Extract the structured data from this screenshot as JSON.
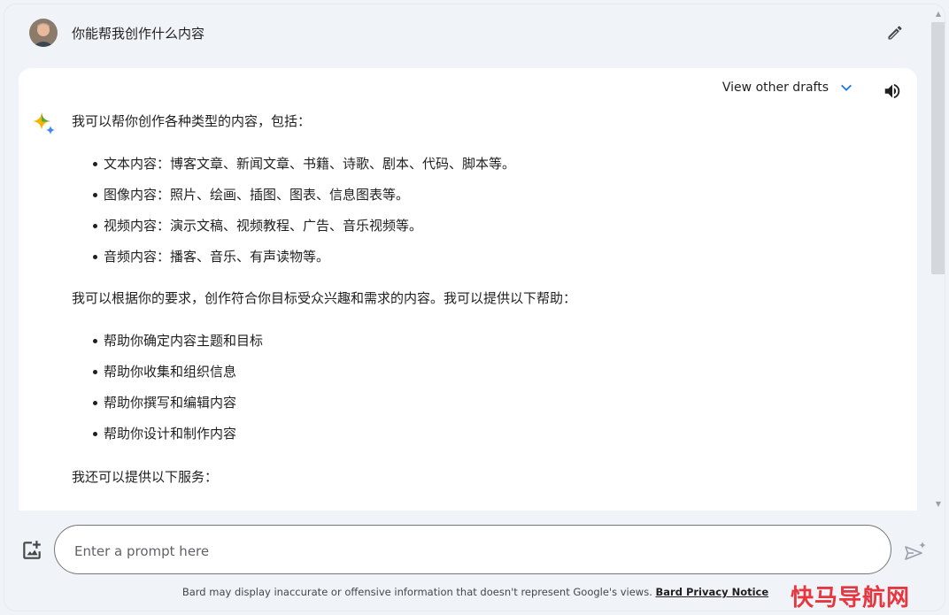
{
  "query": {
    "text": "你能帮我创作什么内容"
  },
  "response": {
    "view_drafts_label": "View other drafts",
    "intro": "我可以帮你创作各种类型的内容，包括：",
    "content_types": [
      "文本内容：博客文章、新闻文章、书籍、诗歌、剧本、代码、脚本等。",
      "图像内容：照片、绘画、插图、图表、信息图表等。",
      "视频内容：演示文稿、视频教程、广告、音乐视频等。",
      "音频内容：播客、音乐、有声读物等。"
    ],
    "middle": "我可以根据你的要求，创作符合你目标受众兴趣和需求的内容。我可以提供以下帮助：",
    "help_items": [
      "帮助你确定内容主题和目标",
      "帮助你收集和组织信息",
      "帮助你撰写和编辑内容",
      "帮助你设计和制作内容"
    ],
    "closing": "我还可以提供以下服务："
  },
  "prompt": {
    "placeholder": "Enter a prompt here"
  },
  "footer": {
    "disclaimer": "Bard may display inaccurate or offensive information that doesn't represent Google's views.",
    "privacy_link": "Bard Privacy Notice"
  },
  "watermark": "快马导航网",
  "colors": {
    "accent": "#1a73e8",
    "page_bg": "#f0f4f9",
    "card_bg": "#ffffff"
  },
  "icons": {
    "avatar": "user-avatar",
    "edit": "pencil-icon",
    "drafts_toggle": "chevron-down-icon",
    "speaker": "speaker-icon",
    "bard": "sparkle-icon",
    "upload": "image-upload-icon",
    "send": "send-icon"
  }
}
